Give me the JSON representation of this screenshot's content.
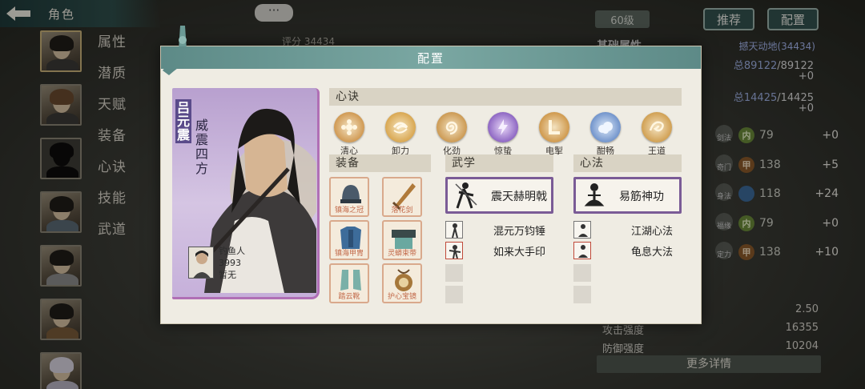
{
  "header": {
    "back_icon": "back-arrow-icon",
    "title": "角色",
    "chat_icon": "···"
  },
  "sidebar": {
    "menu": [
      "属性",
      "潜质",
      "天赋",
      "装备",
      "心诀",
      "技能",
      "武道"
    ]
  },
  "top_right": {
    "level": "60级",
    "recommend_label": "推荐",
    "config_label": "配置",
    "score_label": "评分",
    "score_value": "34434"
  },
  "right_panel": {
    "title": "基础属性",
    "link": "撼天动地(34434)",
    "hp_total": "总89122",
    "hp_current": "/89122",
    "hp_plus": "+0",
    "mp_total": "总14425",
    "mp_current": "/14425",
    "mp_plus": "+0",
    "stats": [
      {
        "icon": "剑法",
        "badge": "内",
        "value": "79",
        "plus": "+0"
      },
      {
        "icon": "奇门",
        "badge": "甲",
        "value": "138",
        "plus": "+5"
      },
      {
        "icon": "身法",
        "badge": "",
        "value": "118",
        "plus": "+24"
      },
      {
        "icon": "福缘",
        "badge": "内",
        "value": "79",
        "plus": "+0"
      },
      {
        "icon": "定力",
        "badge": "甲",
        "value": "138",
        "plus": "+10"
      }
    ],
    "bottom": [
      {
        "label": "",
        "value": "2.50"
      },
      {
        "label": "攻击强度",
        "value": "16355"
      },
      {
        "label": "防御强度",
        "value": "10204"
      }
    ],
    "more_label": "更多详情"
  },
  "modal": {
    "title": "配置",
    "character": {
      "name": "吕元震",
      "title": "威震四方",
      "owner_name": "钓鱼人",
      "owner_score": "3993",
      "owner_status": "暂无"
    },
    "xinjue_header": "心诀",
    "xinjue": [
      {
        "label": "清心",
        "color": "#c98a3c",
        "icon": "flower-icon"
      },
      {
        "label": "卸力",
        "color": "#d39a3a",
        "icon": "swirl-icon"
      },
      {
        "label": "化劲",
        "color": "#c48b3d",
        "icon": "spiral-icon"
      },
      {
        "label": "惊蛰",
        "color": "#7b4fb8",
        "icon": "lightning-icon"
      },
      {
        "label": "电掣",
        "color": "#c88a35",
        "icon": "slash-icon"
      },
      {
        "label": "酣畅",
        "color": "#5b82c2",
        "icon": "cloud-icon"
      },
      {
        "label": "王道",
        "color": "#c9923c",
        "icon": "dragon-icon"
      }
    ],
    "equipment_header": "装备",
    "equipment": [
      {
        "name": "镇海之冠",
        "icon": "helmet-icon"
      },
      {
        "name": "落花剑",
        "icon": "sword-icon"
      },
      {
        "name": "镇海甲胄",
        "icon": "armor-icon"
      },
      {
        "name": "灵蟒束带",
        "icon": "belt-icon"
      },
      {
        "name": "踏云靴",
        "icon": "boots-icon"
      },
      {
        "name": "护心宝镜",
        "icon": "amulet-icon"
      }
    ],
    "wuxue_header": "武学",
    "wuxue_main": "震天赫明戟",
    "wuxue_list": [
      "混元万钧锤",
      "如来大手印"
    ],
    "xinfa_header": "心法",
    "xinfa_main": "易筋神功",
    "xinfa_list": [
      "江湖心法",
      "龟息大法"
    ]
  }
}
